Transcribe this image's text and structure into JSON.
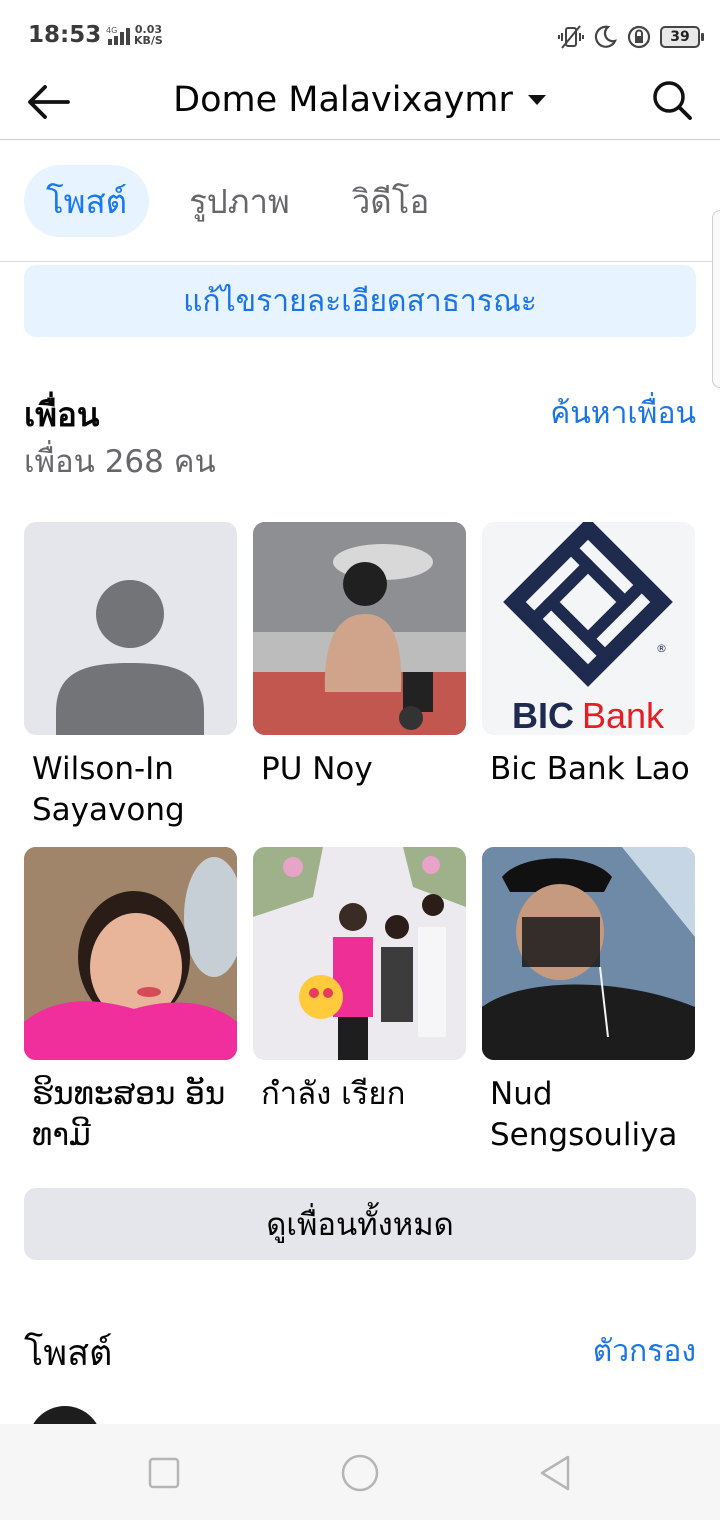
{
  "status_bar": {
    "time": "18:53",
    "network_type": "4G",
    "speed_value": "0.03",
    "speed_unit": "KB/S",
    "battery": "39"
  },
  "header": {
    "title": "Dome Malavixaymr"
  },
  "tabs": [
    {
      "label": "โพสต์",
      "active": true
    },
    {
      "label": "รูปภาพ",
      "active": false
    },
    {
      "label": "วิดีโอ",
      "active": false
    }
  ],
  "edit_public_details": "แก้ไขรายละเอียดสาธารณะ",
  "friends": {
    "title": "เพื่อน",
    "count_text": "เพื่อน 268 คน",
    "find_friends": "ค้นหาเพื่อน",
    "list": [
      {
        "name": "Wilson-In Sayavong",
        "photo": "default-avatar"
      },
      {
        "name": "PU Noy",
        "photo": "photo"
      },
      {
        "name": "Bic Bank Lao",
        "photo": "bic-bank-logo"
      },
      {
        "name": "ຮິນທະສອນ ອັນທາມີ",
        "photo": "photo"
      },
      {
        "name": "กำลัง เรียก",
        "photo": "photo"
      },
      {
        "name": "Nud Sengsouliya",
        "photo": "photo"
      }
    ],
    "see_all": "ดูเพื่อนทั้งหมด",
    "bic_logo": {
      "text_bic": "BIC",
      "text_bank": "Bank",
      "registered": "®"
    }
  },
  "posts": {
    "title": "โพสต์",
    "filter": "ตัวกรอง"
  },
  "colors": {
    "accent": "#1877f2",
    "link": "#1b74e4",
    "tab_active_bg": "#e7f3ff",
    "button_gray": "#e4e6eb",
    "bic_navy": "#1e2b4f",
    "bic_red": "#e31e24"
  }
}
